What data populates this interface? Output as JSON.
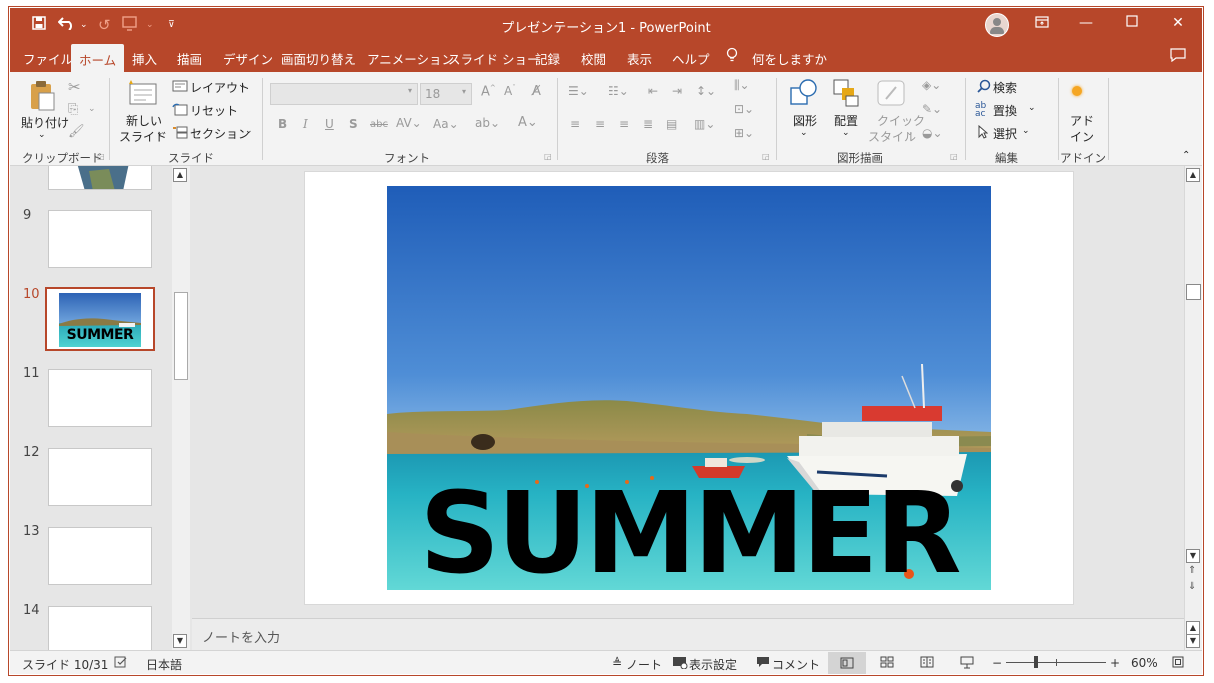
{
  "window": {
    "title": "プレゼンテーション1 - PowerPoint",
    "accent": "#b7472a"
  },
  "tabs": [
    "ファイル",
    "ホーム",
    "挿入",
    "描画",
    "デザイン",
    "画面切り替え",
    "アニメーション",
    "スライド ショー",
    "記録",
    "校閲",
    "表示",
    "ヘルプ"
  ],
  "active_tab": "ホーム",
  "tell_me": "何をしますか",
  "ribbon": {
    "clipboard": {
      "paste": "貼り付け",
      "label": "クリップボード"
    },
    "slides": {
      "new_slide_1": "新しい",
      "new_slide_2": "スライド",
      "layout": "レイアウト",
      "reset": "リセット",
      "section": "セクション",
      "label": "スライド"
    },
    "font": {
      "size": "18",
      "label": "フォント"
    },
    "paragraph": {
      "label": "段落"
    },
    "drawing": {
      "shapes": "図形",
      "arrange": "配置",
      "quick_style_1": "クイック",
      "quick_style_2": "スタイル",
      "label": "図形描画"
    },
    "editing": {
      "find": "検索",
      "replace": "置換",
      "select": "選択",
      "label": "編集"
    },
    "addins": {
      "label_1": "アド",
      "label_2": "イン",
      "label": "アドイン"
    }
  },
  "thumbnails": [
    {
      "num": "9"
    },
    {
      "num": "10",
      "caption": "SUMMER"
    },
    {
      "num": "11"
    },
    {
      "num": "12"
    },
    {
      "num": "13"
    },
    {
      "num": "14"
    }
  ],
  "slide": {
    "headline": "SUMMER"
  },
  "notes_placeholder": "ノートを入力",
  "status": {
    "slide_counter": "スライド 10/31",
    "language": "日本語",
    "notes": "ノート",
    "display_settings": "表示設定",
    "comments": "コメント",
    "zoom": "60%"
  },
  "icons": [
    "save-icon",
    "undo-icon",
    "redo-icon",
    "paste-icon",
    "cut-icon",
    "copy-icon",
    "format-painter-icon",
    "lightbulb-icon",
    "search-icon",
    "comment-icon",
    "avatar"
  ]
}
